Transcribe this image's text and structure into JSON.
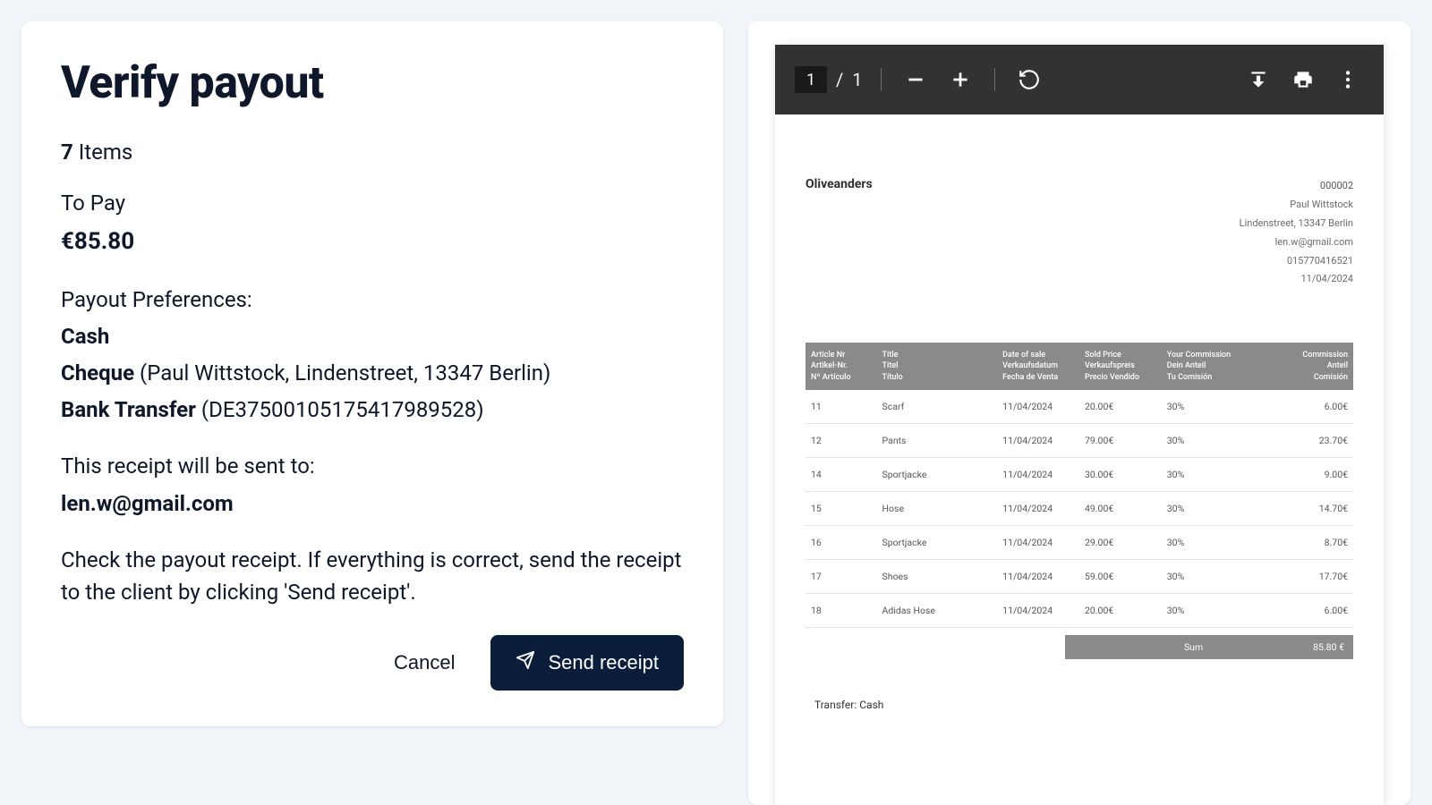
{
  "left": {
    "title": "Verify payout",
    "items_count": "7",
    "items_label": " Items",
    "to_pay_label": "To Pay",
    "amount": "€85.80",
    "pref_heading": "Payout Preferences:",
    "pref_cash": "Cash",
    "pref_cheque_label": "Cheque",
    "pref_cheque_detail": " (Paul Wittstock, Lindenstreet, 13347 Berlin)",
    "pref_bank_label": "Bank Transfer",
    "pref_bank_detail": " (DE37500105175417989528)",
    "sent_to_label": "This receipt will be sent to:",
    "sent_to_email": "len.w@gmail.com",
    "instructions": "Check the payout receipt. If everything is correct, send the receipt to the client by clicking 'Send receipt'.",
    "cancel": "Cancel",
    "send": "Send receipt"
  },
  "pdf_toolbar": {
    "page_current": "1",
    "page_sep": "/",
    "page_total": "1"
  },
  "doc": {
    "brand": "Oliveanders",
    "id": "000002",
    "name": "Paul Wittstock",
    "address": "Lindenstreet, 13347 Berlin",
    "email": "len.w@gmail.com",
    "phone": "015770416521",
    "date": "11/04/2024",
    "headers": {
      "article": "Article Nr\nArtikel-Nr.\nNº Artículo",
      "title": "Title\nTitel\nTítulo",
      "date": "Date of sale\nVerkaufsdatum\nFecha de Venta",
      "price": "Sold Price\nVerkaufspreis\nPrecio Vendido",
      "your_comm": "Your Commission\nDein Anteil\nTu Comisión",
      "comm": "Commission\nAnteil\nComisión"
    },
    "rows": [
      {
        "nr": "11",
        "title": "Scarf",
        "date": "11/04/2024",
        "price": "20.00€",
        "your": "30%",
        "comm": "6.00€"
      },
      {
        "nr": "12",
        "title": "Pants",
        "date": "11/04/2024",
        "price": "79.00€",
        "your": "30%",
        "comm": "23.70€"
      },
      {
        "nr": "14",
        "title": "Sportjacke",
        "date": "11/04/2024",
        "price": "30.00€",
        "your": "30%",
        "comm": "9.00€"
      },
      {
        "nr": "15",
        "title": "Hose",
        "date": "11/04/2024",
        "price": "49.00€",
        "your": "30%",
        "comm": "14.70€"
      },
      {
        "nr": "16",
        "title": "Sportjacke",
        "date": "11/04/2024",
        "price": "29.00€",
        "your": "30%",
        "comm": "8.70€"
      },
      {
        "nr": "17",
        "title": "Shoes",
        "date": "11/04/2024",
        "price": "59.00€",
        "your": "30%",
        "comm": "17.70€"
      },
      {
        "nr": "18",
        "title": "Adidas Hose",
        "date": "11/04/2024",
        "price": "20.00€",
        "your": "30%",
        "comm": "6.00€"
      }
    ],
    "sum_label": "Sum",
    "sum_value": "85.80 €",
    "transfer": "Transfer: Cash"
  }
}
